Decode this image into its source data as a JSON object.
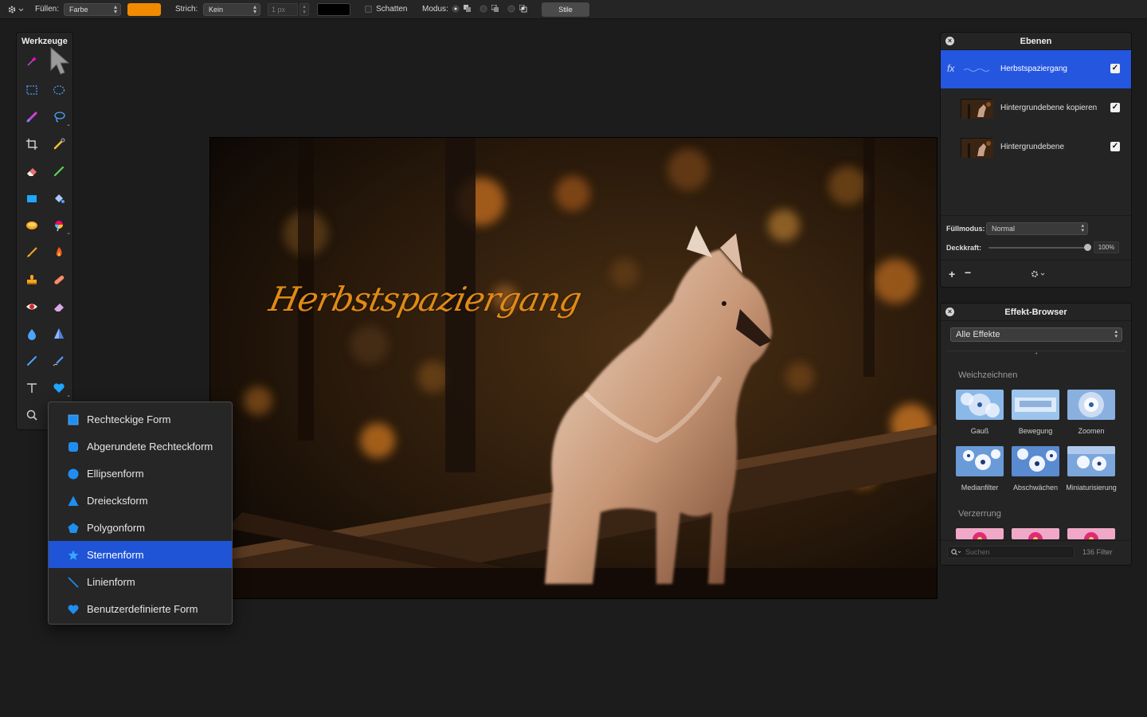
{
  "toolbar": {
    "fill_label": "Füllen:",
    "fill_type": "Farbe",
    "fill_color": "#f28a00",
    "stroke_label": "Strich:",
    "stroke_type": "Kein",
    "stroke_width": "1 px",
    "stroke_color": "#000000",
    "shadow_label": "Schatten",
    "mode_label": "Modus:",
    "styles_button": "Stile"
  },
  "tools_panel": {
    "title": "Werkzeuge"
  },
  "canvas": {
    "title_text": "Herbstspaziergang",
    "title_color": "#e08a17"
  },
  "shape_menu": {
    "items": [
      {
        "label": "Rechteckige Form",
        "icon": "rectangle-shape-icon"
      },
      {
        "label": "Abgerundete Rechteckform",
        "icon": "rounded-rectangle-shape-icon"
      },
      {
        "label": "Ellipsenform",
        "icon": "ellipse-shape-icon"
      },
      {
        "label": "Dreiecksform",
        "icon": "triangle-shape-icon"
      },
      {
        "label": "Polygonform",
        "icon": "polygon-shape-icon"
      },
      {
        "label": "Sternenform",
        "icon": "star-shape-icon",
        "selected": true
      },
      {
        "label": "Linienform",
        "icon": "line-shape-icon"
      },
      {
        "label": "Benutzerdefinierte Form",
        "icon": "heart-shape-icon"
      }
    ]
  },
  "layers_panel": {
    "title": "Ebenen",
    "layers": [
      {
        "name": "Herbstspaziergang",
        "visible": true,
        "selected": true,
        "fx": "fx"
      },
      {
        "name": "Hintergrundebene kopieren",
        "visible": true,
        "selected": false
      },
      {
        "name": "Hintergrundebene",
        "visible": true,
        "selected": false
      }
    ],
    "blend_label": "Füllmodus:",
    "blend_value": "Normal",
    "opacity_label": "Deckkraft:",
    "opacity_value": "100%",
    "opacity_fraction": 1.0
  },
  "effects_panel": {
    "title": "Effekt-Browser",
    "filter_select": "Alle Effekte",
    "sections": [
      {
        "name": "Weichzeichnen",
        "items": [
          "Gauß",
          "Bewegung",
          "Zoomen",
          "Medianfilter",
          "Abschwächen",
          "Miniaturisierung"
        ]
      },
      {
        "name": "Verzerrung",
        "items": []
      }
    ],
    "search_placeholder": "Suchen",
    "filter_count": "136 Filter"
  }
}
